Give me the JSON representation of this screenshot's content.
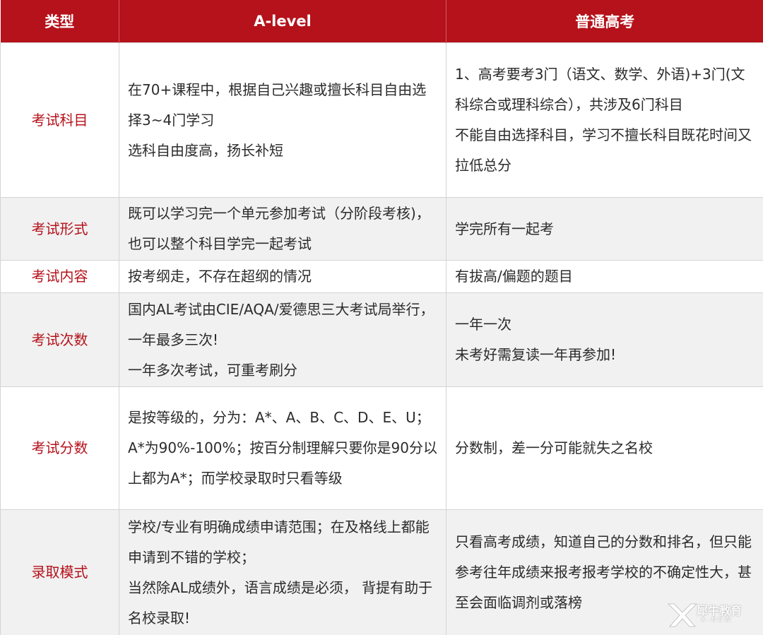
{
  "header": {
    "col_type": "类型",
    "col_alevel": "A-level",
    "col_gaokao": "普通高考"
  },
  "rows": [
    {
      "type": "考试科目",
      "alevel": [
        "在70+课程中，根据自己兴趣或擅长科目自由选择3~4门学习",
        "选科自由度高，扬长补短"
      ],
      "gaokao": [
        "1、高考要考3门（语文、数学、外语)+3门(文科综合或理科综合），共涉及6门科目",
        "不能自由选择科目，学习不擅长科目既花时间又拉低总分"
      ]
    },
    {
      "type": "考试形式",
      "alevel": [
        "既可以学习完一个单元参加考试（分阶段考核)，也可以整个科目学完一起考试"
      ],
      "gaokao": [
        "学完所有一起考"
      ]
    },
    {
      "type": "考试内容",
      "alevel": [
        "按考纲走，不存在超纲的情况"
      ],
      "gaokao": [
        "有拔高/偏题的题目"
      ]
    },
    {
      "type": "考试次数",
      "alevel": [
        "国内AL考试由CIE/AQA/爱德思三大考试局举行，一年最多三次!",
        "一年多次考试，可重考刷分"
      ],
      "gaokao": [
        "一年一次",
        "未考好需复读一年再参加!"
      ]
    },
    {
      "type": "考试分数",
      "alevel": [
        "是按等级的，分为：A*、A、B、C、D、E、U；A*为90%-100%；按百分制理解只要你是90分以上都为A*；而学校录取时只看等级"
      ],
      "gaokao": [
        "分数制，差一分可能就失之名校"
      ]
    },
    {
      "type": "录取模式",
      "alevel": [
        "学校/专业有明确成绩申请范围；在及格线上都能申请到不错的学校；",
        "当然除AL成绩外，语言成绩是必须， 背提有助于名校录取!"
      ],
      "gaokao": [
        "只看高考成绩，知道自己的分数和排名，但只能参考往年成绩来报考报考学校的不确定性大，甚至会面临调剂或落榜"
      ]
    }
  ],
  "watermark": {
    "text": "犀牛教育",
    "sub": "X-NEW"
  }
}
